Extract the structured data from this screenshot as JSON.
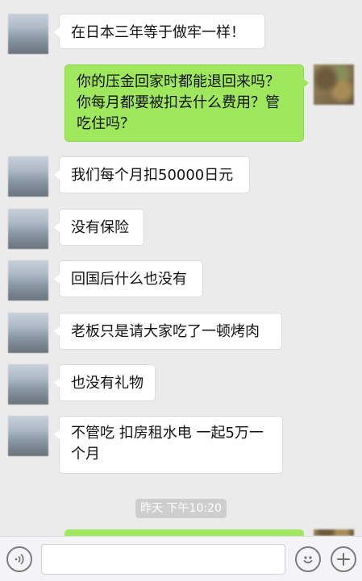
{
  "messages": [
    {
      "side": "in",
      "text": "在日本三年等于做牢一样！"
    },
    {
      "side": "out",
      "lines": [
        "你的压金回家时都能退回来吗？",
        "你每月都要被扣去什么费用？管",
        "吃住吗？"
      ]
    },
    {
      "side": "in",
      "text": "我们每个月扣50000日元"
    },
    {
      "side": "in",
      "text": "没有保险"
    },
    {
      "side": "in",
      "text": "回国后什么也没有"
    },
    {
      "side": "in",
      "text": "老板只是请大家吃了一顿烤肉"
    },
    {
      "side": "in",
      "text": "也没有礼物"
    },
    {
      "side": "in",
      "lines": [
        "不管吃 扣房租水电 一起5万一",
        "个月"
      ]
    }
  ],
  "timestamp": "昨天 下午10:20",
  "input": {
    "value": "",
    "placeholder": ""
  },
  "icons": {
    "voice": "voice-icon",
    "emoji": "emoji-icon",
    "more": "plus-icon"
  },
  "colors": {
    "background": "#ebebeb",
    "outgoing_bubble": "#9fe85e",
    "incoming_bubble": "#ffffff",
    "timestamp_pill": "#cecece"
  }
}
